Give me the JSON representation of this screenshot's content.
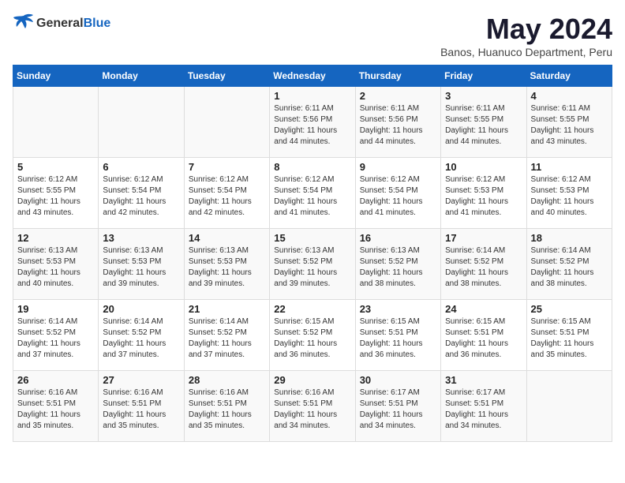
{
  "logo": {
    "general": "General",
    "blue": "Blue"
  },
  "header": {
    "month": "May 2024",
    "location": "Banos, Huanuco Department, Peru"
  },
  "days_of_week": [
    "Sunday",
    "Monday",
    "Tuesday",
    "Wednesday",
    "Thursday",
    "Friday",
    "Saturday"
  ],
  "weeks": [
    [
      {
        "date": "",
        "info": ""
      },
      {
        "date": "",
        "info": ""
      },
      {
        "date": "",
        "info": ""
      },
      {
        "date": "1",
        "info": "Sunrise: 6:11 AM\nSunset: 5:56 PM\nDaylight: 11 hours\nand 44 minutes."
      },
      {
        "date": "2",
        "info": "Sunrise: 6:11 AM\nSunset: 5:56 PM\nDaylight: 11 hours\nand 44 minutes."
      },
      {
        "date": "3",
        "info": "Sunrise: 6:11 AM\nSunset: 5:55 PM\nDaylight: 11 hours\nand 44 minutes."
      },
      {
        "date": "4",
        "info": "Sunrise: 6:11 AM\nSunset: 5:55 PM\nDaylight: 11 hours\nand 43 minutes."
      }
    ],
    [
      {
        "date": "5",
        "info": "Sunrise: 6:12 AM\nSunset: 5:55 PM\nDaylight: 11 hours\nand 43 minutes."
      },
      {
        "date": "6",
        "info": "Sunrise: 6:12 AM\nSunset: 5:54 PM\nDaylight: 11 hours\nand 42 minutes."
      },
      {
        "date": "7",
        "info": "Sunrise: 6:12 AM\nSunset: 5:54 PM\nDaylight: 11 hours\nand 42 minutes."
      },
      {
        "date": "8",
        "info": "Sunrise: 6:12 AM\nSunset: 5:54 PM\nDaylight: 11 hours\nand 41 minutes."
      },
      {
        "date": "9",
        "info": "Sunrise: 6:12 AM\nSunset: 5:54 PM\nDaylight: 11 hours\nand 41 minutes."
      },
      {
        "date": "10",
        "info": "Sunrise: 6:12 AM\nSunset: 5:53 PM\nDaylight: 11 hours\nand 41 minutes."
      },
      {
        "date": "11",
        "info": "Sunrise: 6:12 AM\nSunset: 5:53 PM\nDaylight: 11 hours\nand 40 minutes."
      }
    ],
    [
      {
        "date": "12",
        "info": "Sunrise: 6:13 AM\nSunset: 5:53 PM\nDaylight: 11 hours\nand 40 minutes."
      },
      {
        "date": "13",
        "info": "Sunrise: 6:13 AM\nSunset: 5:53 PM\nDaylight: 11 hours\nand 39 minutes."
      },
      {
        "date": "14",
        "info": "Sunrise: 6:13 AM\nSunset: 5:53 PM\nDaylight: 11 hours\nand 39 minutes."
      },
      {
        "date": "15",
        "info": "Sunrise: 6:13 AM\nSunset: 5:52 PM\nDaylight: 11 hours\nand 39 minutes."
      },
      {
        "date": "16",
        "info": "Sunrise: 6:13 AM\nSunset: 5:52 PM\nDaylight: 11 hours\nand 38 minutes."
      },
      {
        "date": "17",
        "info": "Sunrise: 6:14 AM\nSunset: 5:52 PM\nDaylight: 11 hours\nand 38 minutes."
      },
      {
        "date": "18",
        "info": "Sunrise: 6:14 AM\nSunset: 5:52 PM\nDaylight: 11 hours\nand 38 minutes."
      }
    ],
    [
      {
        "date": "19",
        "info": "Sunrise: 6:14 AM\nSunset: 5:52 PM\nDaylight: 11 hours\nand 37 minutes."
      },
      {
        "date": "20",
        "info": "Sunrise: 6:14 AM\nSunset: 5:52 PM\nDaylight: 11 hours\nand 37 minutes."
      },
      {
        "date": "21",
        "info": "Sunrise: 6:14 AM\nSunset: 5:52 PM\nDaylight: 11 hours\nand 37 minutes."
      },
      {
        "date": "22",
        "info": "Sunrise: 6:15 AM\nSunset: 5:52 PM\nDaylight: 11 hours\nand 36 minutes."
      },
      {
        "date": "23",
        "info": "Sunrise: 6:15 AM\nSunset: 5:51 PM\nDaylight: 11 hours\nand 36 minutes."
      },
      {
        "date": "24",
        "info": "Sunrise: 6:15 AM\nSunset: 5:51 PM\nDaylight: 11 hours\nand 36 minutes."
      },
      {
        "date": "25",
        "info": "Sunrise: 6:15 AM\nSunset: 5:51 PM\nDaylight: 11 hours\nand 35 minutes."
      }
    ],
    [
      {
        "date": "26",
        "info": "Sunrise: 6:16 AM\nSunset: 5:51 PM\nDaylight: 11 hours\nand 35 minutes."
      },
      {
        "date": "27",
        "info": "Sunrise: 6:16 AM\nSunset: 5:51 PM\nDaylight: 11 hours\nand 35 minutes."
      },
      {
        "date": "28",
        "info": "Sunrise: 6:16 AM\nSunset: 5:51 PM\nDaylight: 11 hours\nand 35 minutes."
      },
      {
        "date": "29",
        "info": "Sunrise: 6:16 AM\nSunset: 5:51 PM\nDaylight: 11 hours\nand 34 minutes."
      },
      {
        "date": "30",
        "info": "Sunrise: 6:17 AM\nSunset: 5:51 PM\nDaylight: 11 hours\nand 34 minutes."
      },
      {
        "date": "31",
        "info": "Sunrise: 6:17 AM\nSunset: 5:51 PM\nDaylight: 11 hours\nand 34 minutes."
      },
      {
        "date": "",
        "info": ""
      }
    ]
  ]
}
